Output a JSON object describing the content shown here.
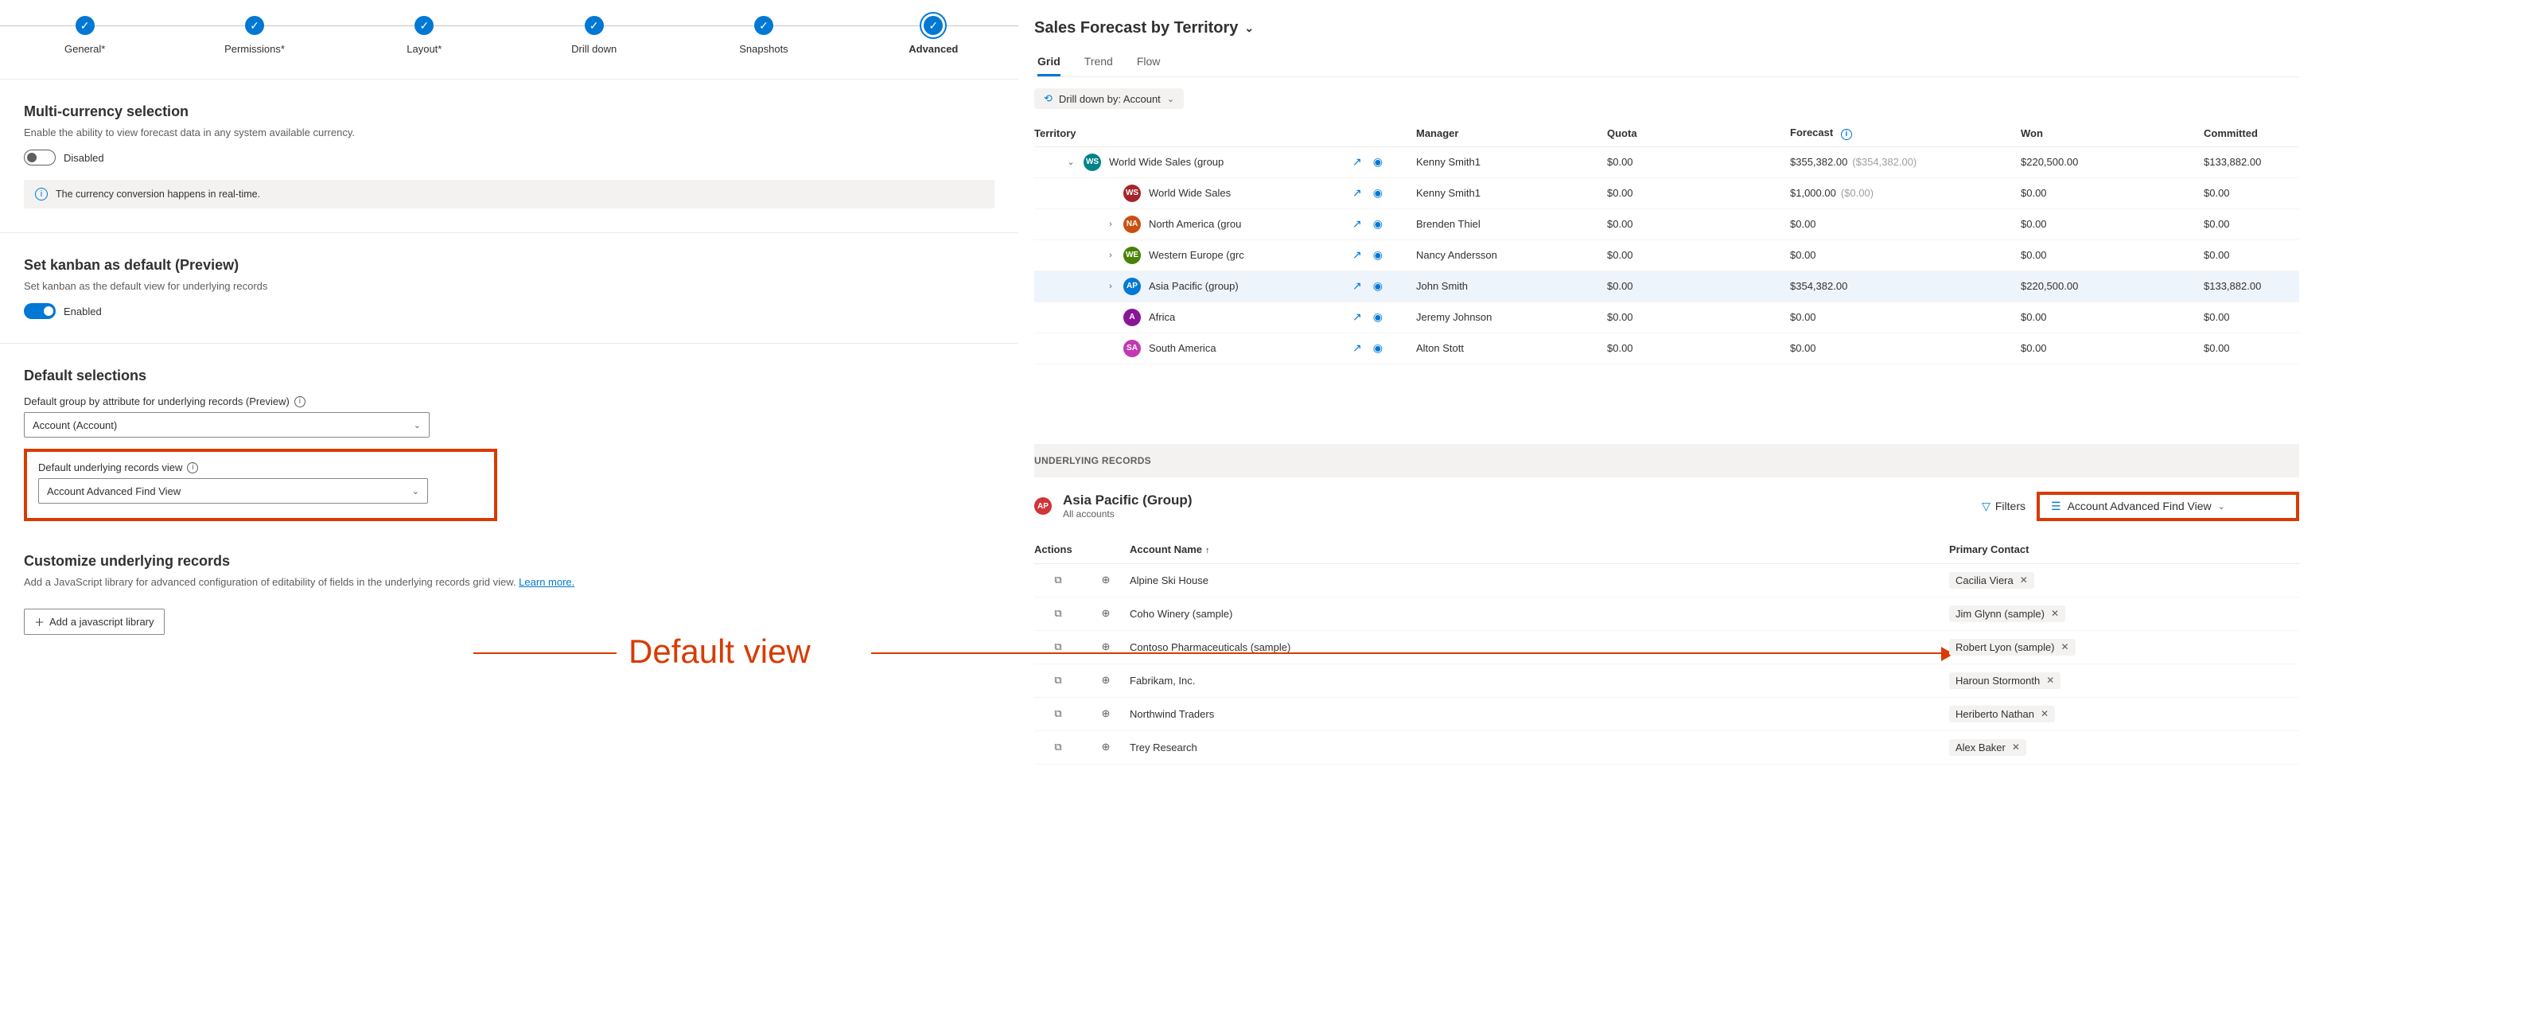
{
  "wizard": {
    "steps": [
      "General*",
      "Permissions*",
      "Layout*",
      "Drill down",
      "Snapshots",
      "Advanced"
    ],
    "activeIndex": 5
  },
  "multiCurrency": {
    "title": "Multi-currency selection",
    "desc": "Enable the ability to view forecast data in any system available currency.",
    "toggleLabel": "Disabled",
    "infoText": "The currency conversion happens in real-time."
  },
  "kanban": {
    "title": "Set kanban as default (Preview)",
    "desc": "Set kanban as the default view for underlying records",
    "toggleLabel": "Enabled"
  },
  "defaultSelections": {
    "title": "Default selections",
    "groupByLabel": "Default group by attribute for underlying records (Preview)",
    "groupByValue": "Account (Account)",
    "viewLabel": "Default underlying records view",
    "viewValue": "Account Advanced Find View"
  },
  "customize": {
    "title": "Customize underlying records",
    "desc1": "Add a JavaScript library for advanced configuration of editability of fields in the underlying records grid view. ",
    "link": "Learn more.",
    "button": "Add a javascript library"
  },
  "annotation": {
    "label": "Default view"
  },
  "forecast": {
    "title": "Sales Forecast by Territory",
    "tabs": [
      "Grid",
      "Trend",
      "Flow"
    ],
    "activeTab": 0,
    "drillPill": "Drill down by: Account",
    "columns": [
      "Territory",
      "Manager",
      "Quota",
      "Forecast",
      "Won",
      "Committed"
    ],
    "rows": [
      {
        "depth": 1,
        "chev": "v",
        "badge": "WS",
        "color": "#038387",
        "name": "World Wide Sales (group",
        "manager": "Kenny Smith1",
        "quota": "$0.00",
        "forecast": "$355,382.00",
        "forecast2": "($354,382.00)",
        "won": "$220,500.00",
        "committed": "$133,882.00",
        "selected": false
      },
      {
        "depth": 2,
        "chev": "",
        "badge": "WS",
        "color": "#a4262c",
        "name": "World Wide Sales",
        "manager": "Kenny Smith1",
        "quota": "$0.00",
        "forecast": "$1,000.00",
        "forecast2": "($0.00)",
        "won": "$0.00",
        "committed": "$0.00",
        "selected": false
      },
      {
        "depth": 2,
        "chev": ">",
        "badge": "NA",
        "color": "#ca5010",
        "name": "North America (grou",
        "manager": "Brenden Thiel",
        "quota": "$0.00",
        "forecast": "$0.00",
        "forecast2": "",
        "won": "$0.00",
        "committed": "$0.00",
        "selected": false
      },
      {
        "depth": 2,
        "chev": ">",
        "badge": "WE",
        "color": "#498205",
        "name": "Western Europe (grc",
        "manager": "Nancy Andersson",
        "quota": "$0.00",
        "forecast": "$0.00",
        "forecast2": "",
        "won": "$0.00",
        "committed": "$0.00",
        "selected": false
      },
      {
        "depth": 2,
        "chev": ">",
        "badge": "AP",
        "color": "#0078d4",
        "name": "Asia Pacific (group)",
        "manager": "John Smith",
        "quota": "$0.00",
        "forecast": "$354,382.00",
        "forecast2": "",
        "won": "$220,500.00",
        "committed": "$133,882.00",
        "selected": true
      },
      {
        "depth": 2,
        "chev": "",
        "badge": "A",
        "color": "#881798",
        "name": "Africa",
        "manager": "Jeremy Johnson",
        "quota": "$0.00",
        "forecast": "$0.00",
        "forecast2": "",
        "won": "$0.00",
        "committed": "$0.00",
        "selected": false
      },
      {
        "depth": 2,
        "chev": "",
        "badge": "SA",
        "color": "#c239b3",
        "name": "South America",
        "manager": "Alton Stott",
        "quota": "$0.00",
        "forecast": "$0.00",
        "forecast2": "",
        "won": "$0.00",
        "committed": "$0.00",
        "selected": false
      }
    ]
  },
  "underlying": {
    "barLabel": "UNDERLYING RECORDS",
    "badge": "AP",
    "badgeColor": "#d13438",
    "title": "Asia Pacific (Group)",
    "subtitle": "All accounts",
    "filters": "Filters",
    "viewPicker": "Account Advanced Find View",
    "columns": [
      "Actions",
      "Account Name",
      "Primary Contact"
    ],
    "rows": [
      {
        "name": "Alpine Ski House",
        "contact": "Cacilia Viera"
      },
      {
        "name": "Coho Winery (sample)",
        "contact": "Jim Glynn (sample)"
      },
      {
        "name": "Contoso Pharmaceuticals (sample)",
        "contact": "Robert Lyon (sample)"
      },
      {
        "name": "Fabrikam, Inc.",
        "contact": "Haroun Stormonth"
      },
      {
        "name": "Northwind Traders",
        "contact": "Heriberto Nathan"
      },
      {
        "name": "Trey Research",
        "contact": "Alex Baker"
      }
    ]
  }
}
